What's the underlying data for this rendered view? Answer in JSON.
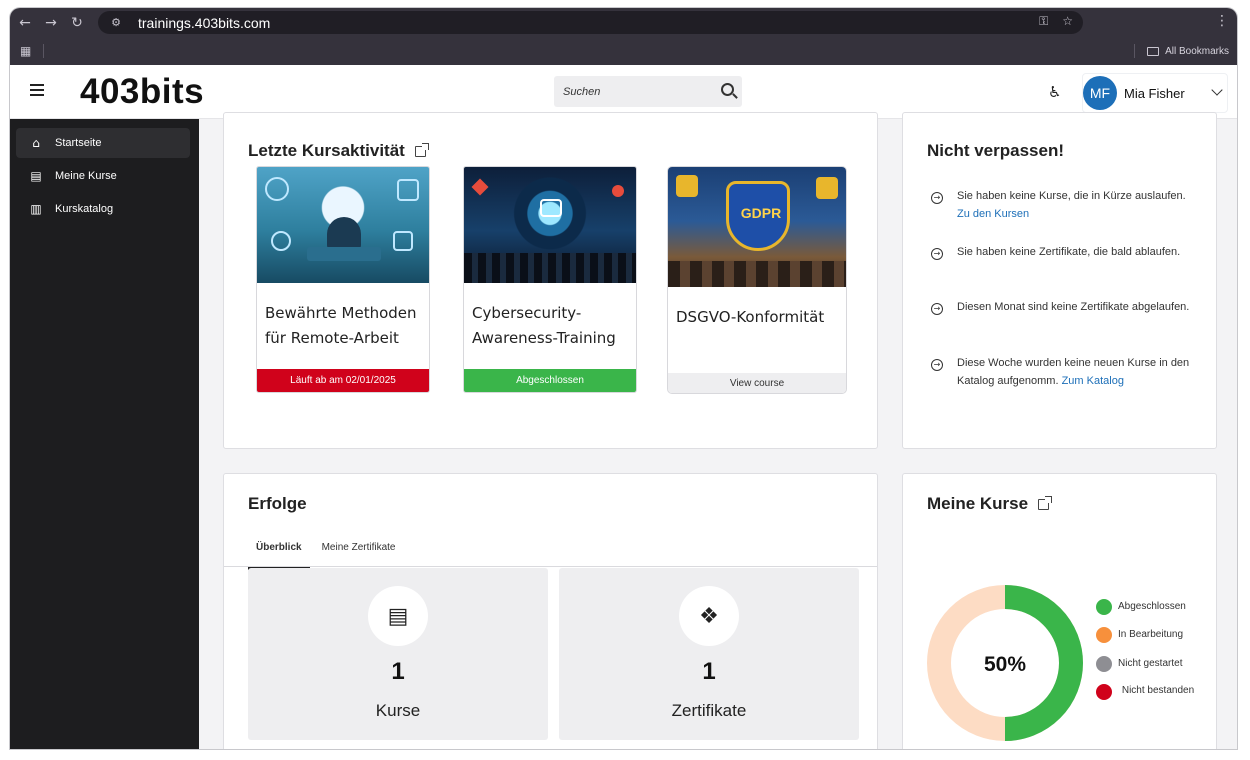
{
  "browser": {
    "url": "trainings.403bits.com",
    "all_bookmarks": "All Bookmarks"
  },
  "header": {
    "logo": "403bits",
    "search_placeholder": "Suchen",
    "user_initials": "MF",
    "user_name": "Mia Fisher",
    "avatar_color": "#1d6fb8"
  },
  "sidebar": {
    "items": [
      {
        "label": "Startseite",
        "icon": "home-icon",
        "active": true
      },
      {
        "label": "Meine Kurse",
        "icon": "courses-icon",
        "active": false
      },
      {
        "label": "Kurskatalog",
        "icon": "catalog-icon",
        "active": false
      }
    ]
  },
  "recent": {
    "title": "Letzte Kursaktivität",
    "courses": [
      {
        "title": "Bewährte Methoden für Remote-Arbeit",
        "badge": "Läuft ab am 02/01/2025",
        "badge_color": "#d0021b"
      },
      {
        "title": "Cybersecurity-Awareness-Training",
        "badge": "Abgeschlossen",
        "badge_color": "#3ab54a"
      },
      {
        "title": "DSGVO-Konformität",
        "badge": "View course",
        "badge_color": "#eeeef0",
        "image_text": "GDPR"
      }
    ]
  },
  "notices": {
    "title": "Nicht verpassen!",
    "items": [
      {
        "text": "Sie haben keine Kurse, die in Kürze auslaufen.",
        "link": "Zu den Kursen"
      },
      {
        "text": "Sie haben keine Zertifikate, die bald ablaufen.",
        "link": ""
      },
      {
        "text": "Diesen Monat sind keine Zertifikate abgelaufen.",
        "link": ""
      },
      {
        "text": "Diese Woche wurden keine neuen Kurse in den Katalog aufgenomm.",
        "link": "Zum Katalog"
      }
    ]
  },
  "achievements": {
    "title": "Erfolge",
    "tabs": [
      "Überblick",
      "Meine Zertifikate"
    ],
    "stats": [
      {
        "value": "1",
        "label": "Kurse",
        "icon": "book-icon"
      },
      {
        "value": "1",
        "label": "Zertifikate",
        "icon": "certificate-icon"
      }
    ]
  },
  "my_courses": {
    "title": "Meine Kurse",
    "center_label": "50%",
    "legend": [
      {
        "label": "Abgeschlossen",
        "color": "#3ab54a"
      },
      {
        "label": "In Bearbeitung",
        "color": "#f7903c"
      },
      {
        "label": "Nicht gestartet",
        "color": "#8e8e93"
      },
      {
        "label": "Nicht bestanden",
        "color": "#d0021b"
      }
    ],
    "completed_fraction": 0.5,
    "remaining_color": "#fddcc4"
  }
}
